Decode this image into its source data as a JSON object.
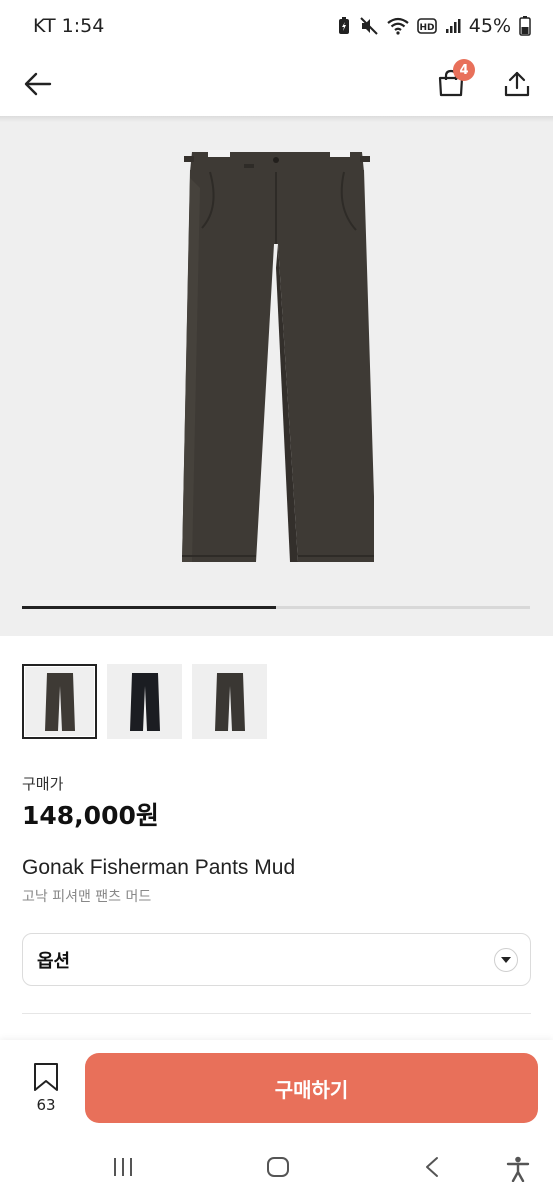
{
  "status_bar": {
    "carrier_time": "KT 1:54",
    "battery": "45%"
  },
  "app_bar": {
    "cart_count": "4"
  },
  "hero": {
    "gallery_progress": 0.5
  },
  "thumbnails": [
    {
      "color": "#3e3a35",
      "selected": true
    },
    {
      "color": "#1b1d22",
      "selected": false
    },
    {
      "color": "#3a3733",
      "selected": false
    }
  ],
  "product": {
    "price_label": "구매가",
    "price": "148,000원",
    "name_en": "Gonak Fisherman Pants Mud",
    "name_ko": "고낙 피셔맨 팬츠 머드"
  },
  "option": {
    "label": "옵션"
  },
  "actions": {
    "bookmark_count": "63",
    "buy_label": "구매하기"
  },
  "colors": {
    "accent": "#e8705a",
    "hero_bg": "#efefef",
    "pants": "#3e3a35"
  }
}
